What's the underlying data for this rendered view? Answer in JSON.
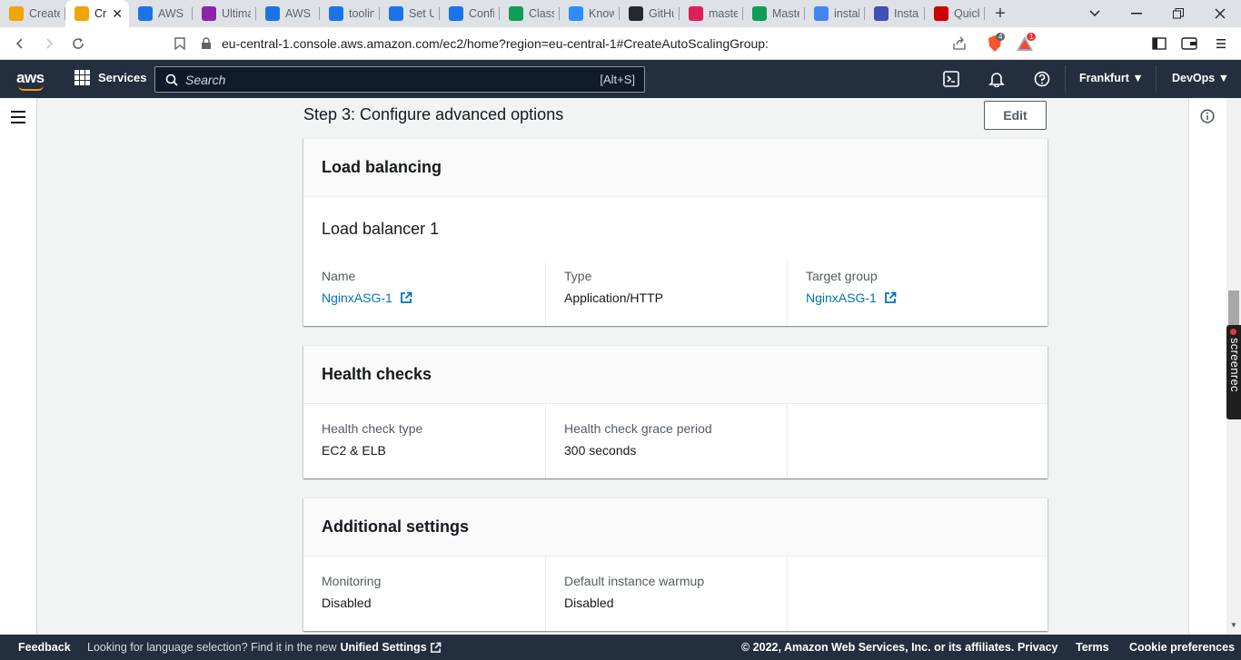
{
  "browser": {
    "tabs": [
      {
        "label": "Create",
        "color": "#f0a500"
      },
      {
        "label": "Cr",
        "color": "#f0a500",
        "active": true
      },
      {
        "label": "AWS S",
        "color": "#1a73e8"
      },
      {
        "label": "Ultima",
        "color": "#8e24aa"
      },
      {
        "label": "AWS C",
        "color": "#1a73e8"
      },
      {
        "label": "toolin",
        "color": "#1a73e8"
      },
      {
        "label": "Set Up",
        "color": "#1a73e8"
      },
      {
        "label": "Config",
        "color": "#1a73e8"
      },
      {
        "label": "Class",
        "color": "#0f9d58"
      },
      {
        "label": "Know",
        "color": "#2d8cff"
      },
      {
        "label": "GitHu",
        "color": "#24292e"
      },
      {
        "label": "maste",
        "color": "#e01e5a"
      },
      {
        "label": "Maste",
        "color": "#0f9d58"
      },
      {
        "label": "install",
        "color": "#4285f4"
      },
      {
        "label": "Install",
        "color": "#3f51b5"
      },
      {
        "label": "Quick",
        "color": "#cc0000"
      }
    ],
    "url": "eu-central-1.console.aws.amazon.com/ec2/home?region=eu-central-1#CreateAutoScalingGroup:",
    "brave_badge": "4",
    "rewards_badge": "1"
  },
  "aws_header": {
    "logo": "aws",
    "services_label": "Services",
    "search_placeholder": "Search",
    "search_shortcut": "[Alt+S]",
    "region": "Frankfurt ▼",
    "account": "DevOps ▼"
  },
  "step": {
    "title": "Step 3: Configure advanced options",
    "edit_label": "Edit"
  },
  "load_balancing": {
    "heading": "Load balancing",
    "subheading": "Load balancer 1",
    "name_label": "Name",
    "name_value": "NginxASG-1",
    "type_label": "Type",
    "type_value": "Application/HTTP",
    "target_label": "Target group",
    "target_value": "NginxASG-1"
  },
  "health_checks": {
    "heading": "Health checks",
    "type_label": "Health check type",
    "type_value": "EC2 & ELB",
    "grace_label": "Health check grace period",
    "grace_value": "300 seconds"
  },
  "additional_settings": {
    "heading": "Additional settings",
    "monitoring_label": "Monitoring",
    "monitoring_value": "Disabled",
    "warmup_label": "Default instance warmup",
    "warmup_value": "Disabled"
  },
  "screenrec": "screenrec",
  "footer": {
    "feedback": "Feedback",
    "lang_text": "Looking for language selection? Find it in the new",
    "lang_link": "Unified Settings",
    "copyright": "© 2022, Amazon Web Services, Inc. or its affiliates.",
    "privacy": "Privacy",
    "terms": "Terms",
    "cookies": "Cookie preferences"
  }
}
